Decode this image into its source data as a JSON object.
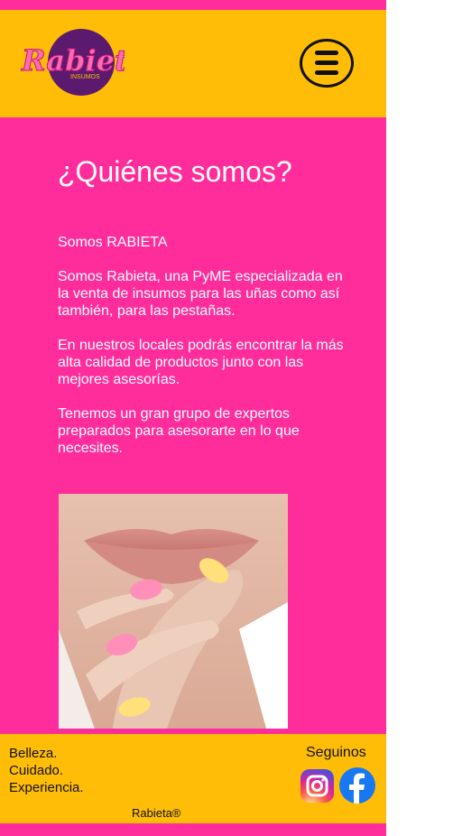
{
  "header": {
    "logo_text": "Rabieta",
    "logo_sub": "INSUMOS",
    "menu_icon": "hamburger-menu-icon"
  },
  "main": {
    "title": "¿Quiénes somos?",
    "paragraphs": [
      "Somos RABIETA",
      "Somos Rabieta, una PyME especializada en la venta de insumos para las uñas como así también, para las pestañas.",
      "En nuestros locales podrás encontrar la más alta calidad de productos junto con las mejores asesorías.",
      "Tenemos un gran grupo de expertos preparados para asesorarte en lo que necesites."
    ]
  },
  "footer": {
    "tagline": [
      "Belleza.",
      "Cuidado.",
      "Experiencia."
    ],
    "follow_label": "Seguinos",
    "copyright": "Rabieta®",
    "social": [
      "instagram-icon",
      "facebook-icon"
    ]
  },
  "colors": {
    "pink": "#ff2d9b",
    "yellow": "#ffbd07",
    "logo_purple": "#5b1a6e"
  }
}
